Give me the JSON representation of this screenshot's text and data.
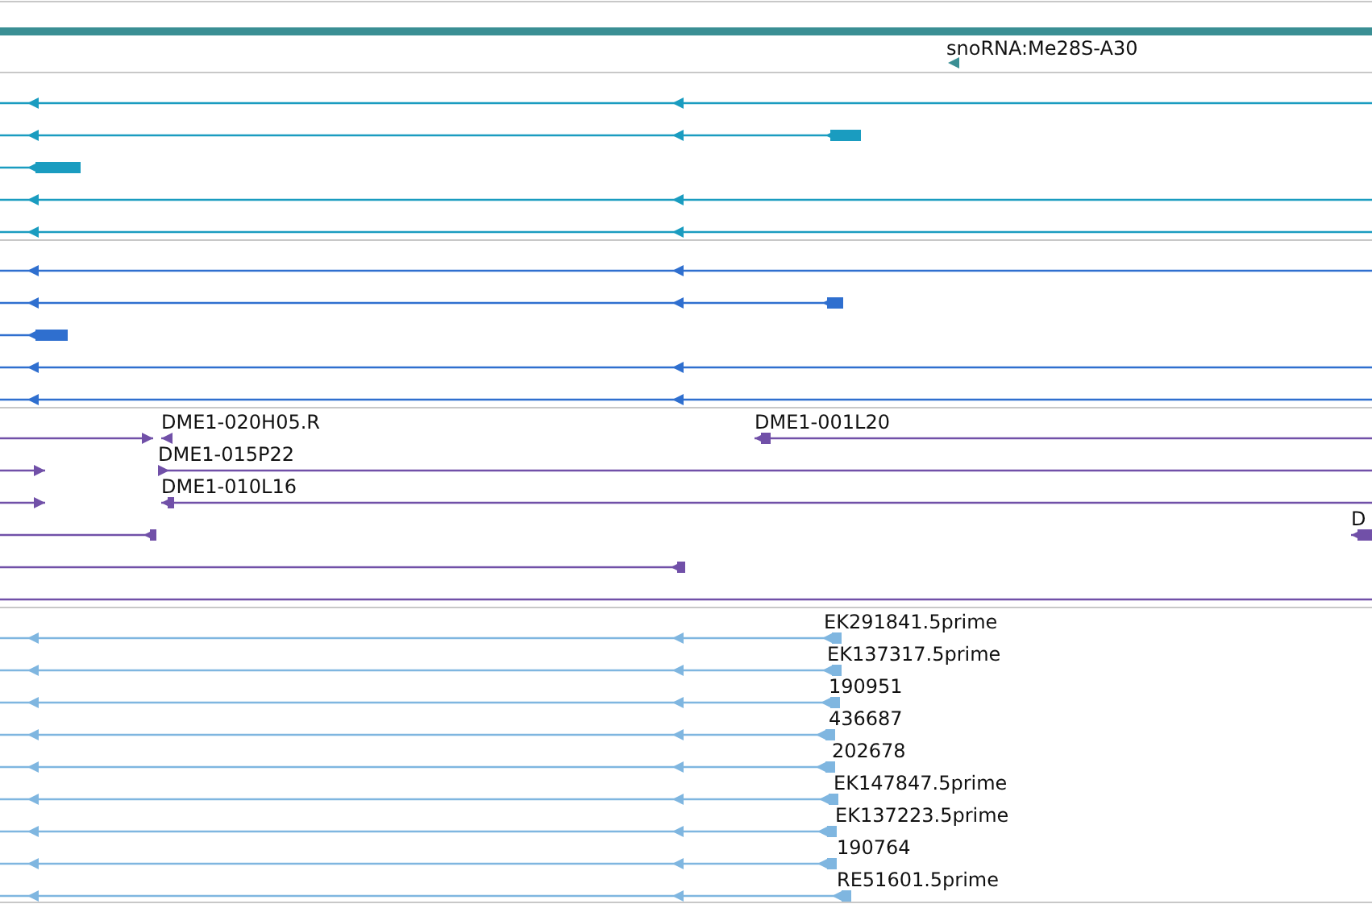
{
  "tracks": [
    {
      "kind": "gene",
      "color": "#3a8f94",
      "labels": [
        "snoRNA:Me28S-A30"
      ]
    },
    {
      "kind": "transcripts",
      "color": "#1a9cc0"
    },
    {
      "kind": "transcripts",
      "color": "#2f6fcf"
    },
    {
      "kind": "clones",
      "color": "#7150a8",
      "labels": [
        "DME1-020H05.R",
        "DME1-001L20",
        "DME1-015P22",
        "DME1-010L16",
        "D"
      ]
    },
    {
      "kind": "ests",
      "color": "#7fb6e0",
      "labels": [
        "EK291841.5prime",
        "EK137317.5prime",
        "190951",
        "436687",
        "202678",
        "EK147847.5prime",
        "EK137223.5prime",
        "190764",
        "RE51601.5prime"
      ]
    }
  ]
}
